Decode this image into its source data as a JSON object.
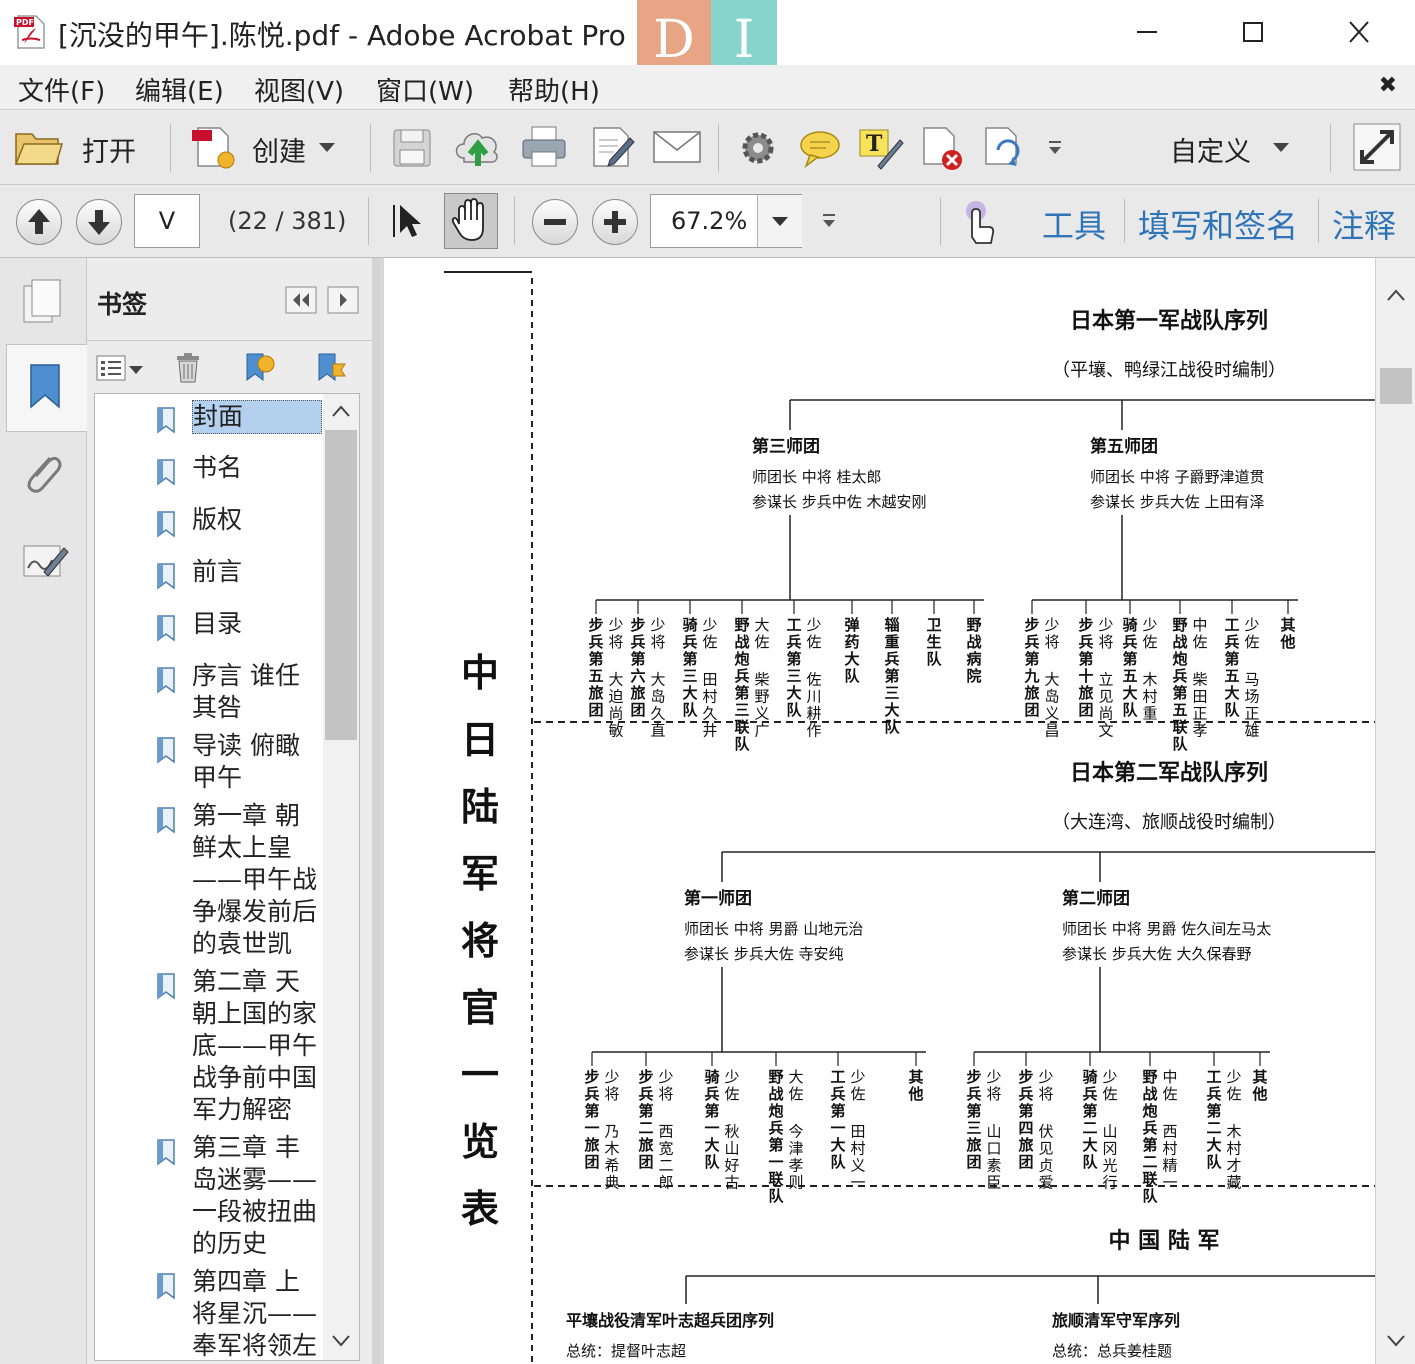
{
  "window": {
    "title": "[沉没的甲午].陈悦.pdf - Adobe Acrobat Pro",
    "overlay_letters": [
      "D",
      "I"
    ]
  },
  "menu": [
    "文件(F)",
    "编辑(E)",
    "视图(V)",
    "窗口(W)",
    "帮助(H)"
  ],
  "toolbar": {
    "open_label": "打开",
    "create_label": "创建",
    "customize_label": "自定义"
  },
  "nav": {
    "page_input": "V",
    "page_count": "(22 / 381)",
    "zoom": "67.2%"
  },
  "panels": {
    "tools": "工具",
    "fill_sign": "填写和签名",
    "comment": "注释"
  },
  "bookmarks": {
    "title": "书签",
    "items": [
      "封面",
      "书名",
      "版权",
      "前言",
      "目录",
      "序言  谁任其咎",
      "导读  俯瞰甲午",
      "第一章  朝鲜太上皇——甲午战争爆发前后的袁世凯",
      "第二章  天朝上国的家底——甲午战争前中国军力解密",
      "第三章  丰岛迷雾——一段被扭曲的历史",
      "第四章  上将星沉——奉军将领左"
    ]
  },
  "document": {
    "vertical_title": "中日陆军将官一览表",
    "army1": {
      "title": "日本第一军战队序列",
      "subtitle": "（平壤、鸭绿江战役时编制）",
      "divA": {
        "name": "第三师团",
        "line1": "师团长  中将  桂太郎",
        "line2": "参谋长  步兵中佐  木越安刚",
        "units": [
          [
            "步兵第五旅团",
            "少将  大迫尚敏"
          ],
          [
            "步兵第六旅团",
            "少将  大岛久直"
          ],
          [
            "骑兵第三大队",
            "少佐  田村久井"
          ],
          [
            "野战炮兵第三联队",
            "大佐  柴野义广"
          ],
          [
            "工兵第三大队",
            "少佐  佐川耕作"
          ],
          [
            "弹药大队",
            ""
          ],
          [
            "辎重兵第三大队",
            ""
          ],
          [
            "卫生队",
            ""
          ],
          [
            "野战病院",
            ""
          ]
        ]
      },
      "divB": {
        "name": "第五师团",
        "line1": "师团长  中将  子爵野津道贯",
        "line2": "参谋长  步兵大佐  上田有泽",
        "units": [
          [
            "步兵第九旅团",
            "少将  大岛义昌"
          ],
          [
            "步兵第十旅团",
            "少将  立见尚文"
          ],
          [
            "骑兵第五大队",
            "少佐  木村重"
          ],
          [
            "野战炮兵第五联队",
            "中佐  柴田正孝"
          ],
          [
            "工兵第五大队",
            "少佐  马场正雄"
          ],
          [
            "其他",
            ""
          ]
        ]
      }
    },
    "army2": {
      "title": "日本第二军战队序列",
      "subtitle": "（大连湾、旅顺战役时编制）",
      "divA": {
        "name": "第一师团",
        "line1": "师团长  中将  男爵  山地元治",
        "line2": "参谋长  步兵大佐  寺安纯",
        "units": [
          [
            "步兵第一旅团",
            "少将  乃木希典"
          ],
          [
            "步兵第二旅团",
            "少将  西宽二郎"
          ],
          [
            "骑兵第一大队",
            "少佐  秋山好古"
          ],
          [
            "野战炮兵第一联队",
            "大佐  今津孝则"
          ],
          [
            "工兵第一大队",
            "少佐  田村义一"
          ],
          [
            "其他",
            ""
          ]
        ]
      },
      "divB": {
        "name": "第二师团",
        "line1": "师团长  中将  男爵  佐久间左马太",
        "line2": "参谋长  步兵大佐  大久保春野",
        "units": [
          [
            "步兵第三旅团",
            "少将  山口素臣"
          ],
          [
            "步兵第四旅团",
            "少将  伏见贞爱"
          ],
          [
            "骑兵第二大队",
            "少佐  山冈光行"
          ],
          [
            "野战炮兵第二联队",
            "中佐  西村精一"
          ],
          [
            "工兵第二大队",
            "少佐  木村才藏"
          ],
          [
            "其他",
            ""
          ]
        ]
      }
    },
    "china": {
      "title": "中  国  陆  军",
      "left_title": "平壤战役清军叶志超兵团序列",
      "left_sub": "总统：提督叶志超",
      "right_title": "旅顺清军守军序列",
      "right_sub": "总统：总兵姜桂题"
    }
  }
}
